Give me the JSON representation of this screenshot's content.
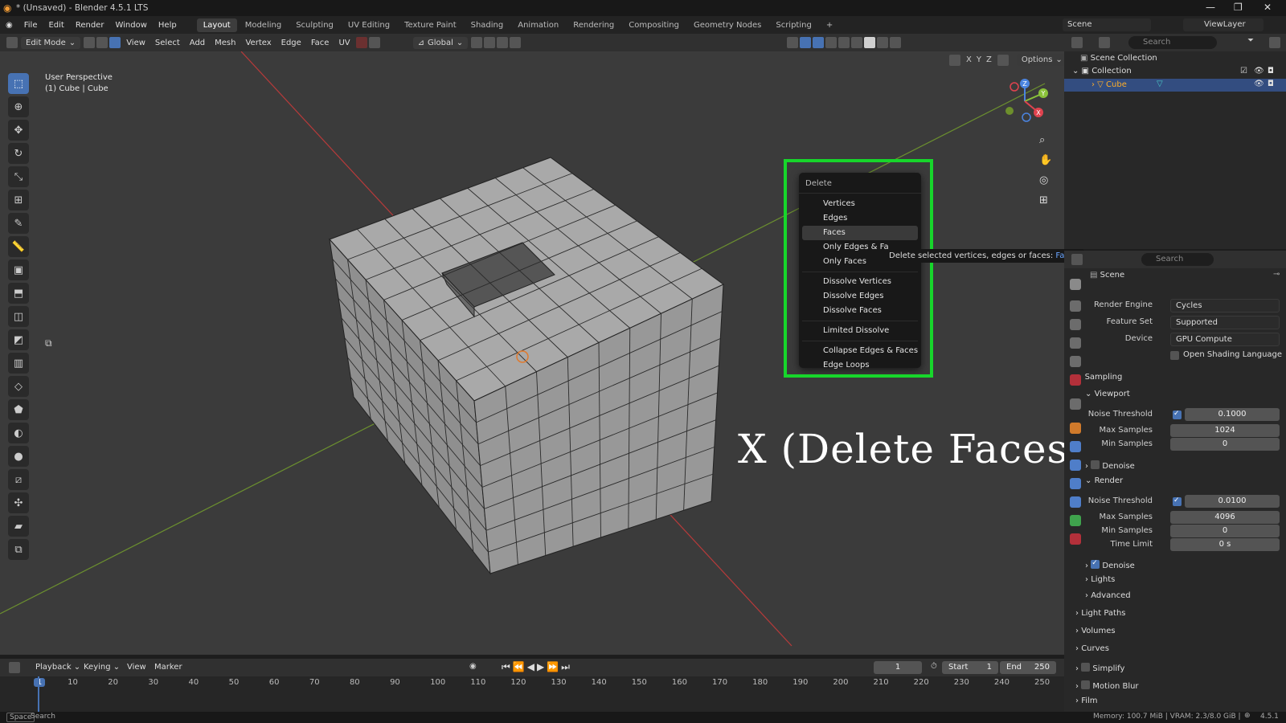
{
  "window": {
    "title": "* (Unsaved) - Blender 4.5.1 LTS"
  },
  "menubar": {
    "items": [
      "File",
      "Edit",
      "Render",
      "Window",
      "Help"
    ],
    "workspaces": [
      "Layout",
      "Modeling",
      "Sculpting",
      "UV Editing",
      "Texture Paint",
      "Shading",
      "Animation",
      "Rendering",
      "Compositing",
      "Geometry Nodes",
      "Scripting"
    ],
    "active_workspace": "Layout",
    "add_tab": "+",
    "scene": "Scene",
    "viewlayer": "ViewLayer"
  },
  "viewport_header": {
    "mode": "Edit Mode",
    "menus": [
      "View",
      "Select",
      "Add",
      "Mesh",
      "Vertex",
      "Edge",
      "Face",
      "UV"
    ],
    "orientation": "Global",
    "options": "Options",
    "axes": [
      "X",
      "Y",
      "Z"
    ]
  },
  "viewport": {
    "perspective": "User Perspective",
    "object_label": "(1) Cube | Cube",
    "gizmo": {
      "z": "Z",
      "y": "Y",
      "x": "X"
    }
  },
  "delete_menu": {
    "title": "Delete",
    "items": [
      {
        "label": "Vertices"
      },
      {
        "label": "Edges"
      },
      {
        "label": "Faces",
        "highlighted": true
      },
      {
        "label": "Only Edges & Fa"
      },
      {
        "label": "Only Faces"
      },
      {
        "sep": true
      },
      {
        "label": "Dissolve Vertices"
      },
      {
        "label": "Dissolve Edges"
      },
      {
        "label": "Dissolve Faces"
      },
      {
        "sep": true
      },
      {
        "label": "Limited Dissolve"
      },
      {
        "sep": true
      },
      {
        "label": "Collapse Edges & Faces"
      },
      {
        "label": "Edge Loops"
      }
    ]
  },
  "tooltip": {
    "text": "Delete selected vertices, edges or faces: ",
    "keyword": "Faces"
  },
  "caption": "X (Delete Faces)",
  "outliner": {
    "search_placeholder": "Search",
    "scene_collection": "Scene Collection",
    "collection": "Collection",
    "object": "Cube"
  },
  "properties": {
    "search_placeholder": "Search",
    "scene": "Scene",
    "render_engine": {
      "label": "Render Engine",
      "value": "Cycles"
    },
    "feature_set": {
      "label": "Feature Set",
      "value": "Supported"
    },
    "device": {
      "label": "Device",
      "value": "GPU Compute"
    },
    "osl": "Open Shading Language",
    "sampling": "Sampling",
    "viewport": "Viewport",
    "render": "Render",
    "vp_noise": {
      "label": "Noise Threshold",
      "value": "0.1000"
    },
    "vp_max": {
      "label": "Max Samples",
      "value": "1024"
    },
    "vp_min": {
      "label": "Min Samples",
      "value": "0"
    },
    "denoise": "Denoise",
    "r_noise": {
      "label": "Noise Threshold",
      "value": "0.0100"
    },
    "r_max": {
      "label": "Max Samples",
      "value": "4096"
    },
    "r_min": {
      "label": "Min Samples",
      "value": "0"
    },
    "r_time": {
      "label": "Time Limit",
      "value": "0 s"
    },
    "lights": "Lights",
    "advanced": "Advanced",
    "light_paths": "Light Paths",
    "volumes": "Volumes",
    "curves": "Curves",
    "simplify": "Simplify",
    "motion_blur": "Motion Blur",
    "film": "Film"
  },
  "timeline": {
    "menus": [
      "Playback",
      "Keying",
      "View",
      "Marker"
    ],
    "current": "1",
    "start_label": "Start",
    "start": "1",
    "end_label": "End",
    "end": "250",
    "ticks": [
      "1",
      "10",
      "20",
      "30",
      "40",
      "50",
      "60",
      "70",
      "80",
      "90",
      "100",
      "110",
      "120",
      "130",
      "140",
      "150",
      "160",
      "170",
      "180",
      "190",
      "200",
      "210",
      "220",
      "230",
      "240",
      "250"
    ]
  },
  "statusbar": {
    "key": "Space",
    "action": "Search",
    "stats": "Memory: 100.7 MiB | VRAM: 2.3/8.0 GiB |",
    "version": "4.5.1"
  },
  "colors": {
    "accent": "#4772b3",
    "highlight_box": "#17d62b",
    "x_axis": "#e0434f",
    "y_axis": "#8ac23a",
    "z_axis": "#4b84e0"
  }
}
